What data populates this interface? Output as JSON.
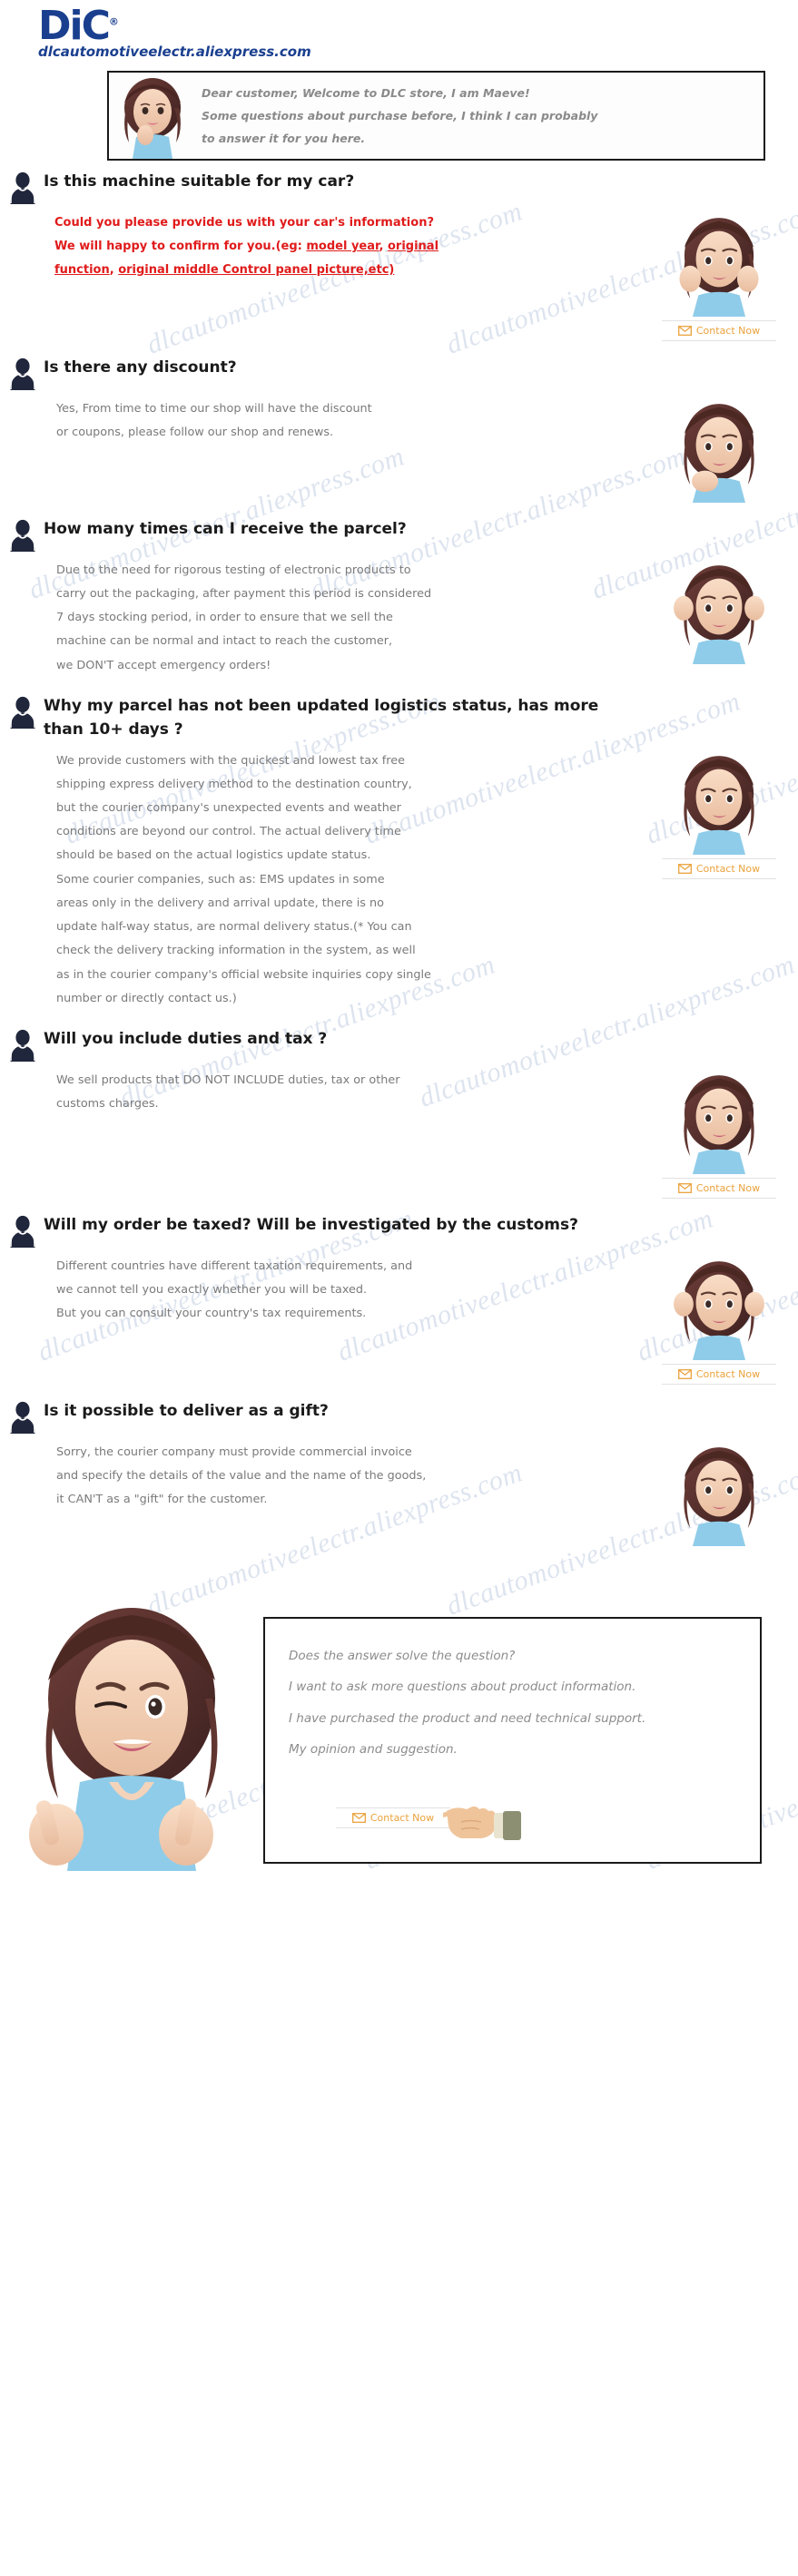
{
  "brand": {
    "logo_text": "DiC",
    "logo_registered": "®",
    "store_url": "dlcautomotiveelectr.aliexpress.com",
    "logo_color": "#1a3f8f",
    "accent_color": "#2a6fd4"
  },
  "welcome": {
    "line1": "Dear customer, Welcome to DLC store, I am Maeve!",
    "line2": "Some questions about purchase before, I think I can probably",
    "line3": "to answer it for you here.",
    "avatar_name": "maeve-chin-rest-avatar"
  },
  "contact_button": {
    "label": "Contact Now",
    "icon": "envelope-icon",
    "color": "#eba23c"
  },
  "watermark": {
    "text": "dlcautomotiveelectr.aliexpress.com",
    "color": "#c3cfe2"
  },
  "faq": [
    {
      "id": "suitable-for-car",
      "question": "Is this machine suitable for my car?",
      "answer_style": "red",
      "answer_lines": [
        [
          {
            "t": "Could you please provide us with your car's information?",
            "u": false
          }
        ],
        [
          {
            "t": "We will happy to confirm for you.(eg: ",
            "u": false
          },
          {
            "t": "model year",
            "u": true
          },
          {
            "t": ", ",
            "u": false
          },
          {
            "t": "original",
            "u": true
          }
        ],
        [
          {
            "t": "function",
            "u": true
          },
          {
            "t": ", ",
            "u": false
          },
          {
            "t": "original middle Control panel picture,etc)",
            "u": true
          }
        ]
      ],
      "figure": "maeve-hands-on-cheeks",
      "has_contact": true
    },
    {
      "id": "any-discount",
      "question": "Is there any discount?",
      "answer_style": "gray",
      "answer_lines": [
        "Yes, From time to time our shop will have the discount",
        "or coupons, please follow our shop and renews."
      ],
      "figure": "maeve-hand-on-chin",
      "has_contact": false
    },
    {
      "id": "receive-parcel-time",
      "question": "How many times can I receive the parcel?",
      "answer_style": "gray",
      "answer_lines": [
        "Due to the need for rigorous testing of electronic products to",
        "carry out the packaging, after payment this period is considered",
        "7 days stocking period, in order to ensure that we sell the",
        "machine can be normal and intact to reach the customer,",
        "we DON'T accept emergency orders!"
      ],
      "figure": "maeve-both-hands-up",
      "has_contact": false
    },
    {
      "id": "logistics-not-updated",
      "question": "Why my parcel has not been updated logistics status, has more than 10+ days ?",
      "answer_style": "gray",
      "answer_lines": [
        "We provide customers with the quickest and lowest tax free",
        "shipping express delivery method to the destination country,",
        "but the courier company's unexpected events and weather",
        "conditions are beyond our control. The actual delivery time",
        "should be based on the actual logistics update status.",
        "Some courier companies, such as: EMS updates in some",
        "areas only in the delivery and arrival update, there is no",
        "update half-way status, are normal delivery status.(* You can",
        "check the delivery tracking information in the system, as well",
        "as in the courier company's official website inquiries copy single",
        "number or directly contact us.)"
      ],
      "figure": "maeve-worried-face",
      "has_contact": true
    },
    {
      "id": "duties-and-tax",
      "question": "Will you include duties and tax ?",
      "answer_style": "gray",
      "answer_lines": [
        "We sell products that DO NOT INCLUDE duties, tax or other",
        "customs charges."
      ],
      "figure": "maeve-arms-crossed",
      "has_contact": true
    },
    {
      "id": "order-taxed-customs",
      "question": "Will my order be taxed? Will be investigated by the customs?",
      "answer_style": "gray",
      "answer_lines": [
        "Different countries have different taxation requirements, and",
        "we cannot tell you exactly whether you will be taxed.",
        "But you can consult your country's tax requirements."
      ],
      "figure": "maeve-hands-up-shrug",
      "has_contact": true
    },
    {
      "id": "deliver-as-gift",
      "question": "Is it possible to deliver as a gift?",
      "answer_style": "gray",
      "answer_lines": [
        "Sorry, the courier company must provide commercial invoice",
        "and specify the details of the value and the name of the goods,",
        "it CAN'T as a \"gift\" for the customer."
      ],
      "figure": "maeve-neutral-pose",
      "has_contact": false
    }
  ],
  "footer": {
    "avatar_name": "maeve-thumbs-pointing-avatar",
    "lines": [
      "Does the answer solve the question?",
      "I want to ask more questions about product information.",
      "I have purchased the product and need technical support.",
      "My opinion and suggestion."
    ],
    "hand_icon": "pointing-hand-icon"
  }
}
